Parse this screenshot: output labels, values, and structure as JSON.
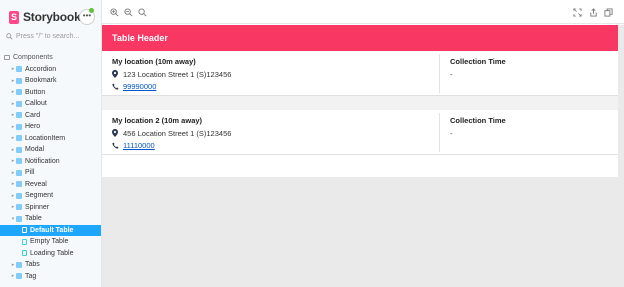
{
  "sidebar": {
    "brand": "Storybook",
    "menu_label": "•••",
    "search_placeholder": "Press \"/\" to search...",
    "root": "Components",
    "items": [
      {
        "label": "Accordion"
      },
      {
        "label": "Bookmark"
      },
      {
        "label": "Button"
      },
      {
        "label": "Callout"
      },
      {
        "label": "Card"
      },
      {
        "label": "Hero"
      },
      {
        "label": "LocationItem"
      },
      {
        "label": "Modal"
      },
      {
        "label": "Notification"
      },
      {
        "label": "Pill"
      },
      {
        "label": "Reveal"
      },
      {
        "label": "Segment"
      },
      {
        "label": "Spinner"
      },
      {
        "label": "Table"
      },
      {
        "label": "Default Table",
        "active": true
      },
      {
        "label": "Empty Table"
      },
      {
        "label": "Loading Table"
      },
      {
        "label": "Tabs"
      },
      {
        "label": "Tag"
      }
    ]
  },
  "toolbar": {
    "icons": [
      "zoom-in-icon",
      "zoom-out-icon",
      "zoom-reset-icon",
      "fullscreen-icon",
      "share-icon",
      "copy-icon"
    ]
  },
  "table": {
    "header": "Table Header",
    "rows": [
      {
        "title": "My location  (10m away)",
        "address": "123 Location Street 1 (S)123456",
        "phone": "99990000",
        "collection_label": "Collection Time",
        "collection_value": "-"
      },
      {
        "title": "My location 2  (10m away)",
        "address": "456 Location Street 1 (S)123456",
        "phone": "11110000",
        "collection_label": "Collection Time",
        "collection_value": "-"
      }
    ]
  },
  "colors": {
    "accent": "#1ea7fd",
    "header": "#f83763",
    "brand": "#ff4785",
    "link": "#0055cc"
  }
}
